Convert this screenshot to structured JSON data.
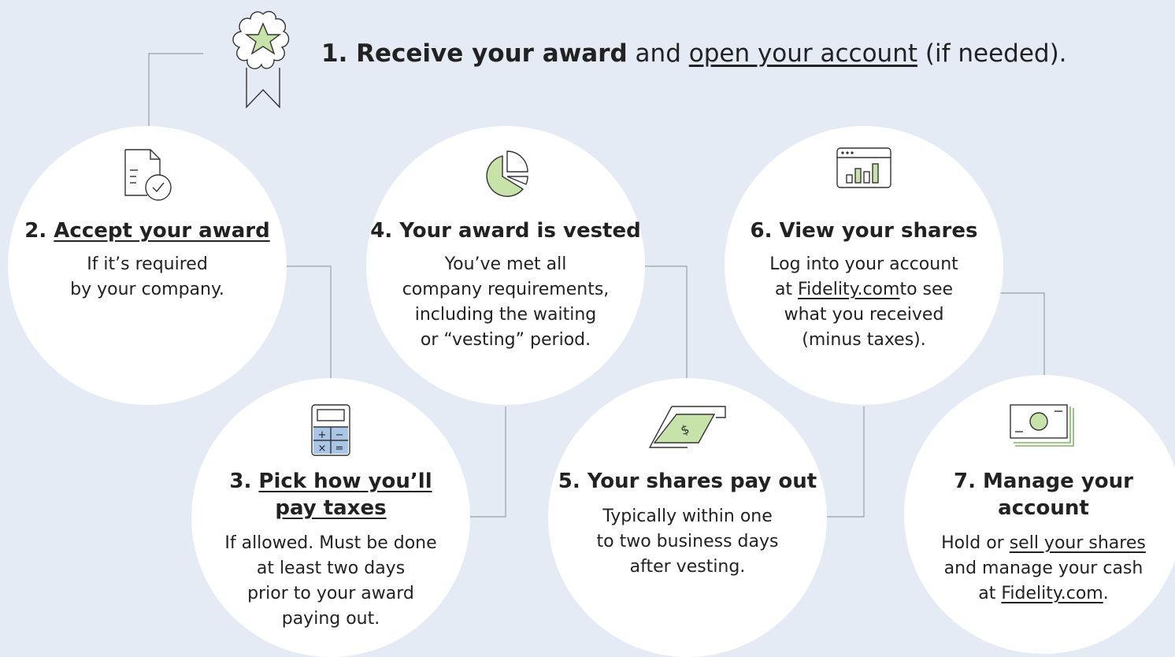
{
  "header": {
    "bold": "1. Receive your award",
    "and": " and ",
    "link": "open your account",
    "suffix": " (if needed)."
  },
  "steps": [
    {
      "num": "2. ",
      "title": "Accept your award",
      "lines": [
        "If it’s required",
        "by your company."
      ]
    },
    {
      "num": "3. ",
      "title1": "Pick how you’ll",
      "title2": "pay taxes",
      "lines": [
        "If allowed. Must be done",
        "at least two days",
        "prior to your award",
        "paying out."
      ]
    },
    {
      "title": "4. Your award is vested",
      "lines": [
        "You’ve met all",
        "company requirements,",
        "including the waiting",
        "or “vesting” period."
      ]
    },
    {
      "title": "5. Your shares pay out",
      "lines": [
        "Typically within one",
        "to two business days",
        "after vesting."
      ]
    },
    {
      "title": "6. View your shares",
      "line1": "Log into your account",
      "line2_pre": "at ",
      "line2_link": "Fidelity.com",
      "line2_post": "to see",
      "line3": "what you received",
      "line4": "(minus  taxes)."
    },
    {
      "title1": "7. Manage your",
      "title2": "account",
      "line1_pre": "Hold or ",
      "line1_link": "sell your shares",
      "line2": "and manage your cash",
      "line3_pre": "at ",
      "line3_link": "Fidelity.com",
      "line3_post": "."
    }
  ],
  "colors": {
    "background": "#e4ebf5",
    "circle": "#ffffff",
    "connector": "#9aa0a8",
    "icon_stroke": "#333333",
    "icon_green": "#c7e3a9",
    "icon_blue": "#a9c6e6"
  }
}
